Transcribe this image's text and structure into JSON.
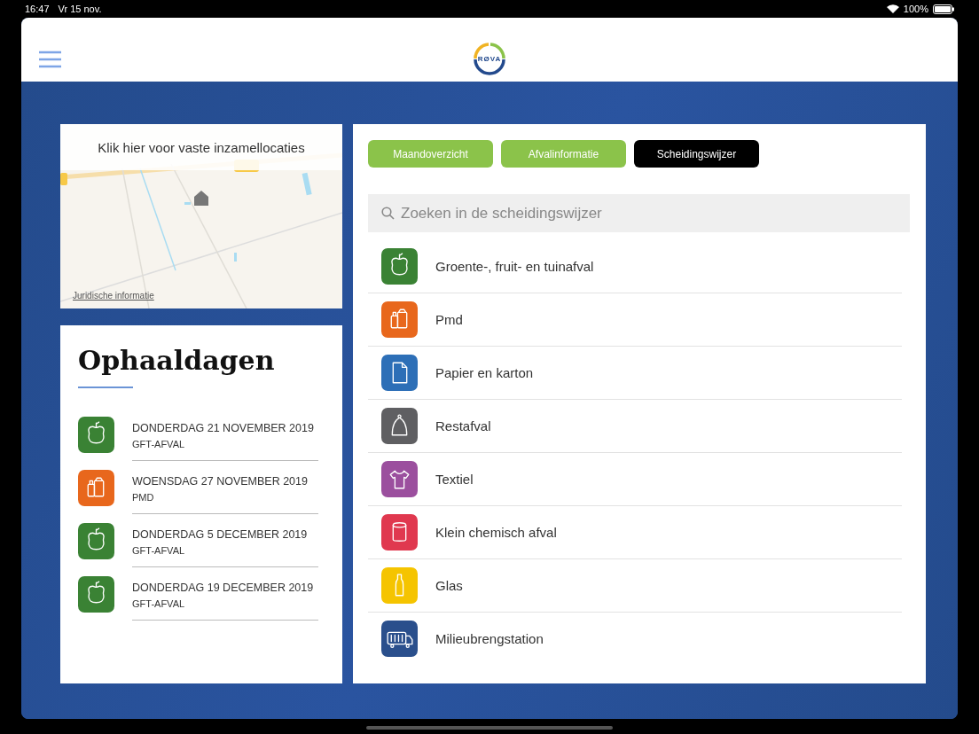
{
  "status_bar": {
    "time": "16:47",
    "date": "Vr 15 nov.",
    "battery": "100%"
  },
  "header": {
    "logo": "RØVA"
  },
  "map": {
    "kind": "picture",
    "caption": "Klik hier voor vaste inzamellocaties",
    "legal_link": "Juridische informatie"
  },
  "pickup": {
    "title": "Ophaaldagen",
    "items": [
      {
        "date": "DONDERDAG 21 NOVEMBER 2019",
        "type": "GFT-AFVAL",
        "kind": "gft",
        "color": "#3a8234"
      },
      {
        "date": "WOENSDAG 27 NOVEMBER 2019",
        "type": "PMD",
        "kind": "pmd",
        "color": "#e8671c"
      },
      {
        "date": "DONDERDAG 5 DECEMBER 2019",
        "type": "GFT-AFVAL",
        "kind": "gft",
        "color": "#3a8234"
      },
      {
        "date": "DONDERDAG 19 DECEMBER 2019",
        "type": "GFT-AFVAL",
        "kind": "gft",
        "color": "#3a8234"
      }
    ]
  },
  "tabs": [
    {
      "label": "Maandoverzicht",
      "selected": false
    },
    {
      "label": "Afvalinformatie",
      "selected": false
    },
    {
      "label": "Scheidingswijzer",
      "selected": true
    }
  ],
  "search": {
    "placeholder": "Zoeken in de scheidingswijzer"
  },
  "categories": [
    {
      "label": "Groente-, fruit- en tuinafval",
      "kind": "gft",
      "color": "#3a8234"
    },
    {
      "label": "Pmd",
      "kind": "pmd",
      "color": "#e8671c"
    },
    {
      "label": "Papier en karton",
      "kind": "paper",
      "color": "#2d6fb7"
    },
    {
      "label": "Restafval",
      "kind": "rest",
      "color": "#5f5f62"
    },
    {
      "label": "Textiel",
      "kind": "textile",
      "color": "#9b4f9e"
    },
    {
      "label": "Klein chemisch afval",
      "kind": "chemical",
      "color": "#e0384f"
    },
    {
      "label": "Glas",
      "kind": "glass",
      "color": "#f5c400"
    },
    {
      "label": "Milieubrengstation",
      "kind": "station",
      "color": "#2a4f8c"
    }
  ]
}
